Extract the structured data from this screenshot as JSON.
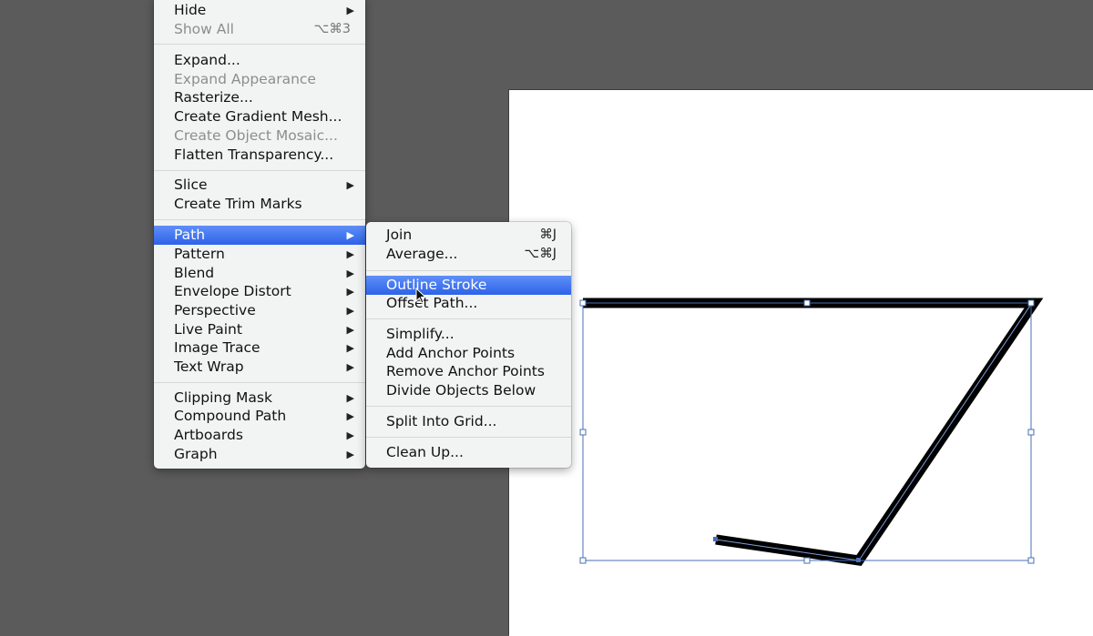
{
  "object_menu": {
    "items": [
      {
        "label": "Hide",
        "submenu": true,
        "enabled": true
      },
      {
        "label": "Show All",
        "shortcut": "⌥⌘3",
        "enabled": false
      },
      {
        "label": "Expand...",
        "enabled": true
      },
      {
        "label": "Expand Appearance",
        "enabled": false
      },
      {
        "label": "Rasterize...",
        "enabled": true
      },
      {
        "label": "Create Gradient Mesh...",
        "enabled": true
      },
      {
        "label": "Create Object Mosaic...",
        "enabled": false
      },
      {
        "label": "Flatten Transparency...",
        "enabled": true
      },
      {
        "label": "Slice",
        "submenu": true,
        "enabled": true
      },
      {
        "label": "Create Trim Marks",
        "enabled": true
      },
      {
        "label": "Path",
        "submenu": true,
        "enabled": true,
        "highlighted": true
      },
      {
        "label": "Pattern",
        "submenu": true,
        "enabled": true
      },
      {
        "label": "Blend",
        "submenu": true,
        "enabled": true
      },
      {
        "label": "Envelope Distort",
        "submenu": true,
        "enabled": true
      },
      {
        "label": "Perspective",
        "submenu": true,
        "enabled": true
      },
      {
        "label": "Live Paint",
        "submenu": true,
        "enabled": true
      },
      {
        "label": "Image Trace",
        "submenu": true,
        "enabled": true
      },
      {
        "label": "Text Wrap",
        "submenu": true,
        "enabled": true
      },
      {
        "label": "Clipping Mask",
        "submenu": true,
        "enabled": true
      },
      {
        "label": "Compound Path",
        "submenu": true,
        "enabled": true
      },
      {
        "label": "Artboards",
        "submenu": true,
        "enabled": true
      },
      {
        "label": "Graph",
        "submenu": true,
        "enabled": true
      }
    ],
    "arrow_glyph": "▶"
  },
  "path_submenu": {
    "items": [
      {
        "label": "Join",
        "shortcut": "⌘J"
      },
      {
        "label": "Average...",
        "shortcut": "⌥⌘J"
      },
      {
        "label": "Outline Stroke",
        "highlighted": true
      },
      {
        "label": "Offset Path..."
      },
      {
        "label": "Simplify..."
      },
      {
        "label": "Add Anchor Points"
      },
      {
        "label": "Remove Anchor Points"
      },
      {
        "label": "Divide Objects Below"
      },
      {
        "label": "Split Into Grid..."
      },
      {
        "label": "Clean Up..."
      }
    ]
  },
  "colors": {
    "highlight": "#3a6cef",
    "selection": "#4a6fb5",
    "pasteboard": "#5b5b5b",
    "stroke": "#000000"
  }
}
